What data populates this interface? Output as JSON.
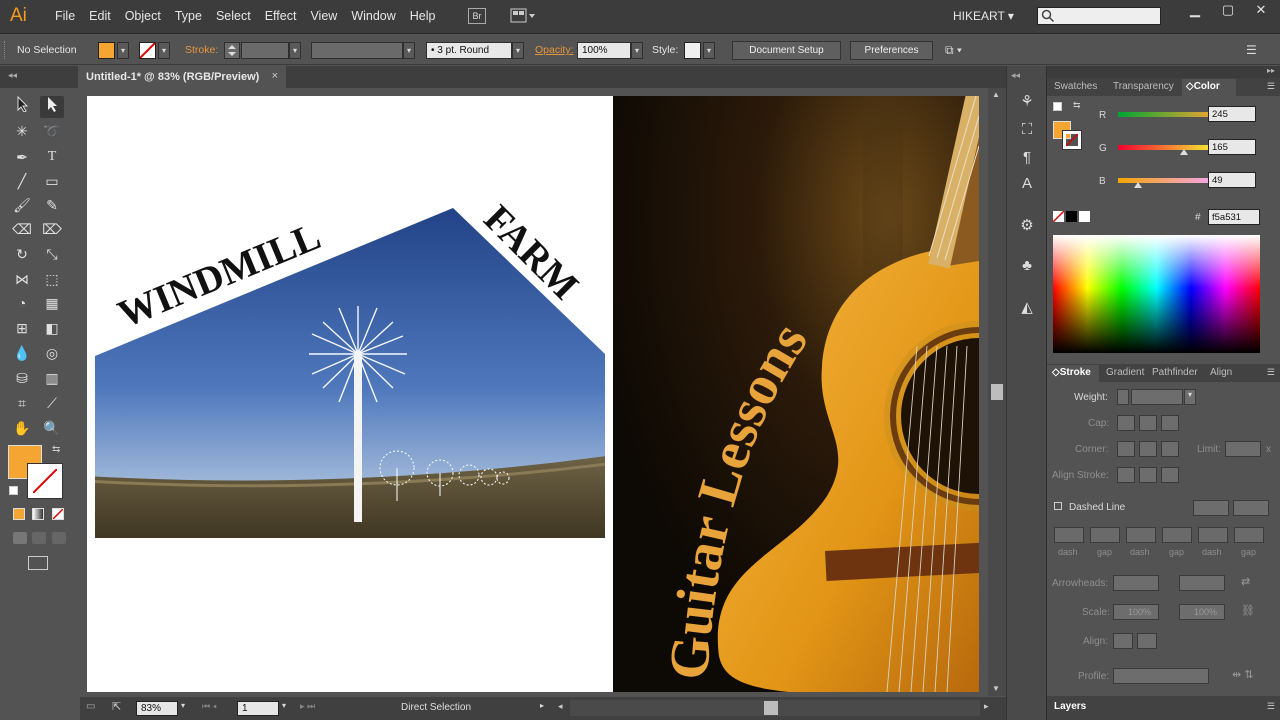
{
  "app": {
    "logo": "Ai",
    "workspace": "HIKEART"
  },
  "menu": {
    "items": [
      "File",
      "Edit",
      "Object",
      "Type",
      "Select",
      "Effect",
      "View",
      "Window",
      "Help"
    ],
    "bridge": "Br"
  },
  "control_bar": {
    "selection": "No Selection",
    "stroke_label": "Stroke:",
    "stroke_profile": "3 pt. Round",
    "opacity_label": "Opacity:",
    "opacity_value": "100%",
    "style_label": "Style:",
    "document_setup": "Document Setup",
    "preferences": "Preferences"
  },
  "document": {
    "tab_title": "Untitled-1* @ 83% (RGB/Preview)",
    "close": "×"
  },
  "artwork": {
    "left_title_1": "WINDMILL",
    "left_title_2": "FARM",
    "right_title": "Guitar Lessons"
  },
  "status_bar": {
    "zoom": "83%",
    "artboard": "1",
    "tool": "Direct Selection"
  },
  "color_panel": {
    "tabs": [
      "Swatches",
      "Transparency",
      "Color"
    ],
    "r_label": "R",
    "g_label": "G",
    "b_label": "B",
    "r_value": "245",
    "g_value": "165",
    "b_value": "49",
    "r": 245,
    "g": 165,
    "b": 49,
    "hex_label": "#",
    "hex_value": "f5a531",
    "fill_color": "#f5a531"
  },
  "stroke_panel": {
    "tabs": [
      "Stroke",
      "Gradient",
      "Pathfinder",
      "Align"
    ],
    "weight": "Weight:",
    "cap": "Cap:",
    "corner": "Corner:",
    "limit": "Limit:",
    "limit_suffix": "x",
    "align_stroke": "Align Stroke:",
    "dashed_line": "Dashed Line",
    "dash_labels": [
      "dash",
      "gap",
      "dash",
      "gap",
      "dash",
      "gap"
    ],
    "arrowheads": "Arrowheads:",
    "scale": "Scale:",
    "scale_1": "100%",
    "scale_2": "100%",
    "align": "Align:",
    "profile": "Profile:"
  },
  "layers_panel": {
    "tab": "Layers"
  }
}
